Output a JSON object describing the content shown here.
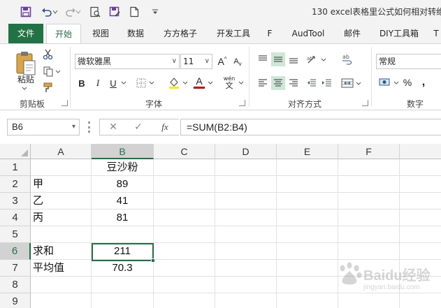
{
  "window": {
    "title": "130 excel表格里公式如何相对转绝"
  },
  "tabs": [
    {
      "label": "文件"
    },
    {
      "label": "开始"
    },
    {
      "label": "视图"
    },
    {
      "label": "数据"
    },
    {
      "label": "方方格子"
    },
    {
      "label": "开发工具"
    },
    {
      "label": "F"
    },
    {
      "label": "AudTool"
    },
    {
      "label": "邮件"
    },
    {
      "label": "DIY工具箱"
    },
    {
      "label": "T"
    }
  ],
  "ribbon": {
    "clipboard": {
      "paste_label": "粘贴",
      "group_label": "剪贴板"
    },
    "font": {
      "font_name": "微软雅黑",
      "font_size": "11",
      "group_label": "字体",
      "bold": "B",
      "italic": "I",
      "underline": "U",
      "grow": "A",
      "shrink": "A",
      "font_color_letter": "A",
      "phonetic": "wén",
      "phonetic_char": "文"
    },
    "alignment": {
      "group_label": "对齐方式"
    },
    "number": {
      "format": "常规",
      "group_label": "数字",
      "percent": "%",
      "comma": ","
    }
  },
  "formula_bar": {
    "name_box": "B6",
    "cancel": "✕",
    "enter": "✓",
    "fx": "fx",
    "formula": "=SUM(B2:B4)"
  },
  "grid": {
    "columns": [
      "A",
      "B",
      "C",
      "D",
      "E",
      "F"
    ],
    "selected_column": "B",
    "rows": [
      {
        "num": "1",
        "a": "",
        "b": "豆沙粉"
      },
      {
        "num": "2",
        "a": "甲",
        "b": "89"
      },
      {
        "num": "3",
        "a": "乙",
        "b": "41"
      },
      {
        "num": "4",
        "a": "丙",
        "b": "81"
      },
      {
        "num": "5",
        "a": "",
        "b": ""
      },
      {
        "num": "6",
        "a": "求和",
        "b": "211"
      },
      {
        "num": "7",
        "a": "平均值",
        "b": "70.3"
      },
      {
        "num": "8",
        "a": "",
        "b": ""
      },
      {
        "num": "9",
        "a": "",
        "b": ""
      }
    ],
    "selected_row": "6"
  },
  "watermark": {
    "text": "Baidu经验",
    "sub": "jingyan.baidu.com"
  },
  "colors": {
    "accent": "#217346",
    "highlight": "#cde8d6"
  }
}
